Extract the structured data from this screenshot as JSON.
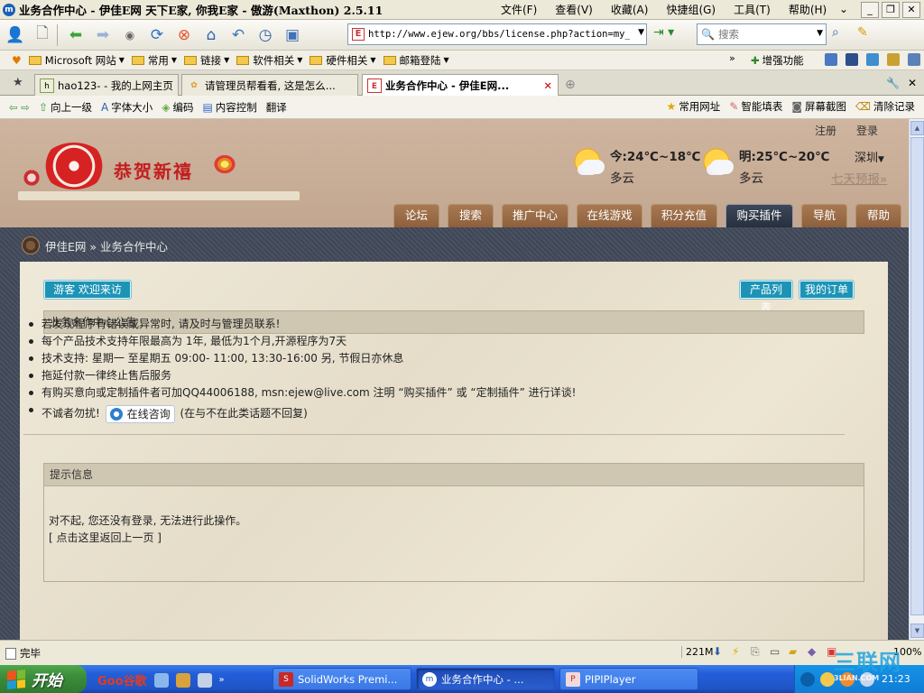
{
  "window": {
    "title": "业务合作中心 - 伊佳E网 天下E家, 你我E家 - 傲游(Maxthon) 2.5.11",
    "menu": [
      "文件(F)",
      "查看(V)",
      "收藏(A)",
      "快捷组(G)",
      "工具(T)",
      "帮助(H)"
    ],
    "buttons": {
      "minimize": "_",
      "restore": "❐",
      "close": "✕"
    }
  },
  "toolbar": {
    "address": "http://www.ejew.org/bbs/license.php?action=my_li:",
    "search_placeholder": "搜索"
  },
  "favorites": {
    "items": [
      "Microsoft 网站",
      "常用",
      "链接",
      "软件相关",
      "硬件相关",
      "邮箱登陆"
    ],
    "more": "»",
    "plugins_label": "增强功能"
  },
  "tabs": [
    {
      "label": "hao123- - 我的上网主页",
      "icon": "hao123-icon"
    },
    {
      "label": "请管理员帮看看, 这是怎么...",
      "icon": "flower-icon"
    },
    {
      "label": "业务合作中心 - 伊佳E网...",
      "icon": "ejew-icon",
      "active": true
    }
  ],
  "helper": {
    "left": [
      "向上一级",
      "字体大小",
      "编码",
      "内容控制",
      "翻译"
    ],
    "right": [
      "常用网址",
      "智能填表",
      "屏幕截图",
      "清除记录"
    ]
  },
  "site": {
    "top_links": [
      "注册",
      "登录"
    ],
    "logo_text": "恭贺新禧",
    "weather_today": {
      "temp": "今:24℃~18℃",
      "cond": "多云"
    },
    "weather_tomorrow": {
      "temp": "明:25℃~20℃",
      "cond": "多云"
    },
    "city": "深圳",
    "forecast_link": "七天预报»",
    "nav": [
      "论坛",
      "搜索",
      "推广中心",
      "在线游戏",
      "积分充值",
      "购买插件",
      "导航",
      "帮助"
    ],
    "nav_current": "购买插件",
    "breadcrumb": "伊佳E网 » 业务合作中心"
  },
  "page": {
    "guest_badge": "游客 欢迎来访",
    "product_list": "产品列表",
    "my_orders": "我的订单",
    "notice_title": "业务合作中心公告",
    "notices": [
      "若发现程序有错误或异常时, 请及时与管理员联系!",
      "每个产品技术支持年限最高为 1年, 最低为1个月,开源程序为7天",
      "技术支持: 星期一 至星期五  09:00- 11:00, 13:30-16:00 另, 节假日亦休息",
      "拖延付款一律终止售后服务",
      "有购买意向或定制插件者可加QQ44006188, msn:ejew@live.com 注明 “购买插件” 或 “定制插件” 进行详谈!"
    ],
    "last_notice_prefix": "不诚者勿扰!",
    "consult_button": "在线咨询",
    "last_notice_suffix": "(在与不在此类话题不回复)",
    "tip_title": "提示信息",
    "tip_message": "对不起, 您还没有登录, 无法进行此操作。",
    "tip_link": "[ 点击这里返回上一页 ]"
  },
  "status": {
    "text": "完毕",
    "memory": "221M",
    "zoom": "100%"
  },
  "taskbar": {
    "start": "开始",
    "quicklaunch_brand": "Goo谷歌",
    "tasks": [
      {
        "label": "SolidWorks Premi...",
        "icon": "solidworks-icon"
      },
      {
        "label": "业务合作中心 - ...",
        "icon": "maxthon-icon",
        "active": true
      },
      {
        "label": "PIPIPlayer",
        "icon": "pipiplayer-icon"
      }
    ],
    "clock": "21:23"
  },
  "watermark": {
    "big": "三联网",
    "small": "3LIAN.COM"
  }
}
